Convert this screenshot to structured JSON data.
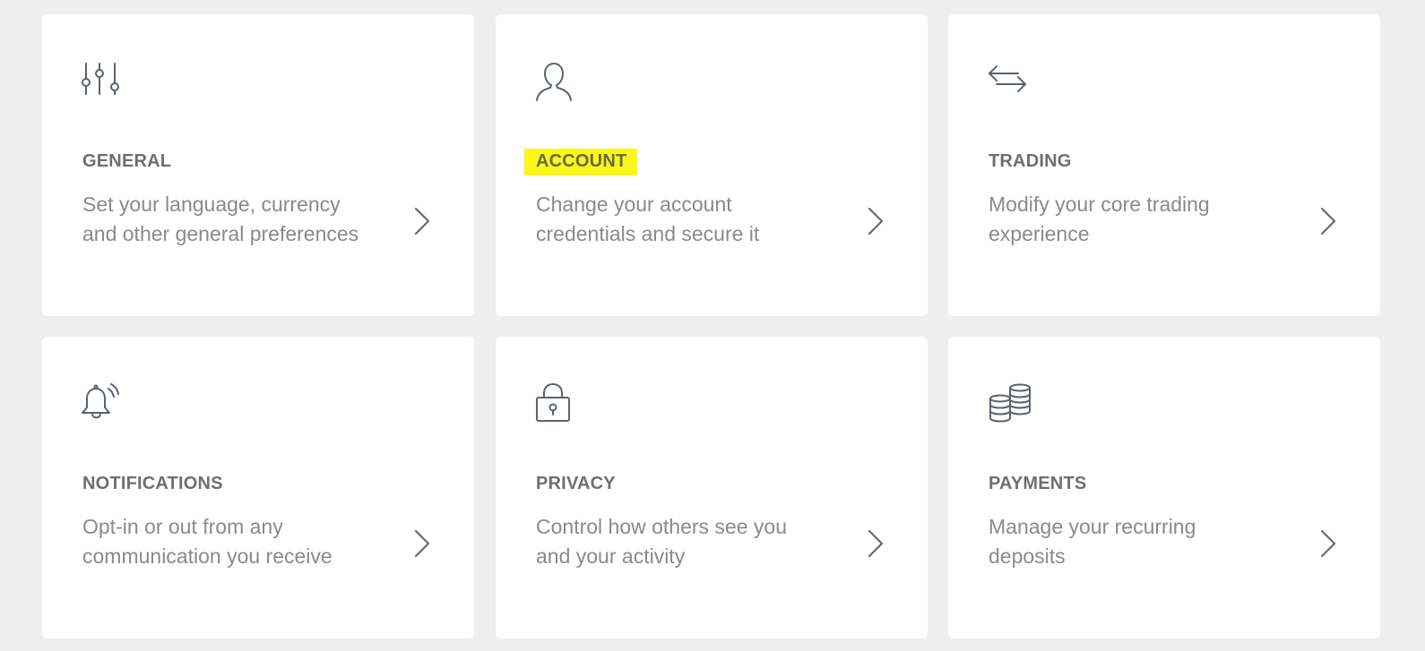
{
  "cards": [
    {
      "title": "GENERAL",
      "description": "Set your language, currency and other general preferences",
      "icon": "sliders-icon"
    },
    {
      "title": "ACCOUNT",
      "description": "Change your account credentials and secure it",
      "icon": "user-icon",
      "highlight_color": "#faf71a"
    },
    {
      "title": "TRADING",
      "description": "Modify your core trading experience",
      "icon": "swap-arrows-icon"
    },
    {
      "title": "NOTIFICATIONS",
      "description": "Opt-in or out from any communication you receive",
      "icon": "bell-icon"
    },
    {
      "title": "PRIVACY",
      "description": "Control how others see you and your activity",
      "icon": "lock-icon"
    },
    {
      "title": "PAYMENTS",
      "description": "Manage your recurring deposits",
      "icon": "coins-icon"
    }
  ],
  "colors": {
    "background": "#efefef",
    "card": "#ffffff",
    "title": "#6f6f6f",
    "description": "#8a8a8a",
    "icon": "#5a6270"
  }
}
